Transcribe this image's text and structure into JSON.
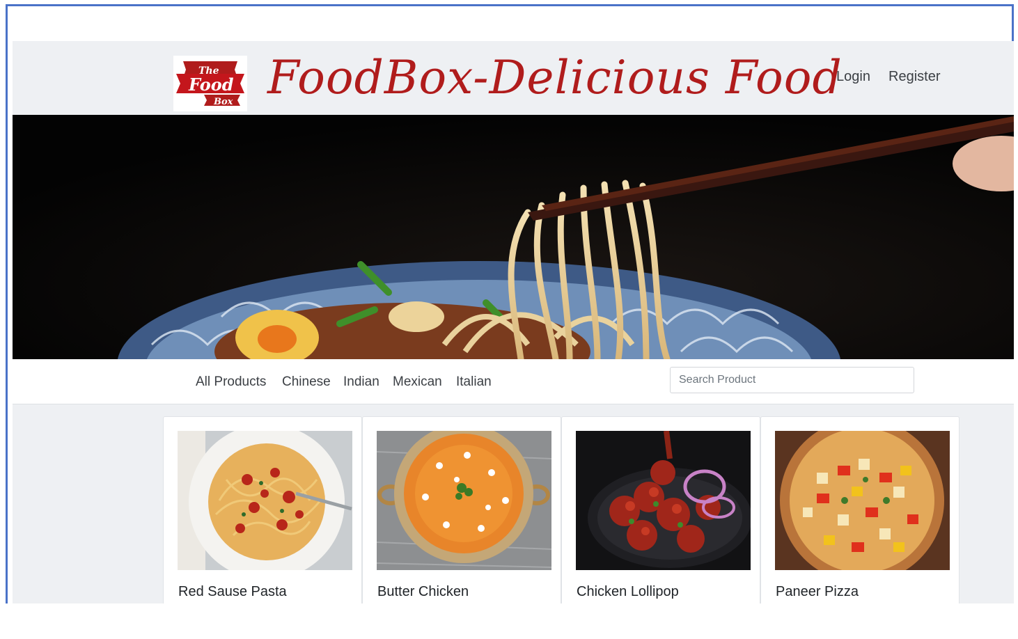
{
  "header": {
    "brand_title": "FoodBox-Delicious Food",
    "logo": {
      "line1": "The",
      "line2": "Food",
      "line3": "Box"
    },
    "nav": {
      "login": "Login",
      "register": "Register"
    }
  },
  "hero": {
    "image": "noodles-with-chopsticks-banner"
  },
  "categories": [
    "All Products",
    "Chinese",
    "Indian",
    "Mexican",
    "Italian"
  ],
  "search": {
    "placeholder": "Search Product",
    "value": ""
  },
  "products": [
    {
      "name": "Red Sause Pasta",
      "image": "pasta-dish"
    },
    {
      "name": "Butter Chicken",
      "image": "butter-chicken-bowl"
    },
    {
      "name": "Chicken Lollipop",
      "image": "chicken-lollipop-plate"
    },
    {
      "name": "Paneer Pizza",
      "image": "paneer-pizza"
    }
  ],
  "colors": {
    "brand_red": "#b01c1c",
    "header_bg": "#eef0f3",
    "frame_border": "#4a72c8"
  }
}
